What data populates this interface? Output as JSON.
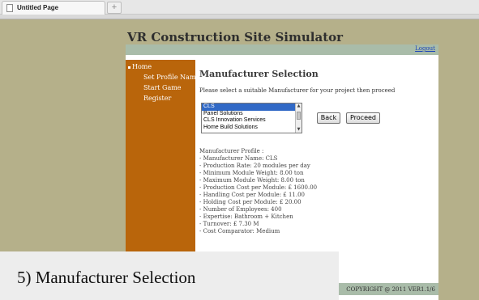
{
  "browser": {
    "tab_title": "Untitled Page",
    "newtab_glyph": "+"
  },
  "site": {
    "title": "VR Construction Site Simulator",
    "logout_label": "Logout"
  },
  "sidebar": {
    "items": [
      {
        "label": "Home"
      },
      {
        "label": "Set Profile Name"
      },
      {
        "label": "Start Game"
      },
      {
        "label": "Register"
      }
    ]
  },
  "main": {
    "heading": "Manufacturer Selection",
    "instruction": "Please select a suitable Manufacturer for your project then proceed",
    "manufacturers": [
      "CLS",
      "Panel Solutions",
      "CLS Innovation Services",
      "Home Build Solutions"
    ],
    "selected_manufacturer": "CLS",
    "back_label": "Back",
    "proceed_label": "Proceed"
  },
  "profile": {
    "title": "Manufacturer Profile :",
    "lines": [
      "- Manufacturer Name: CLS",
      "- Production Rate: 20 modules per day",
      "- Minimum Module Weight: 8.00 ton",
      "- Maximum Module Weight: 8.00 ton",
      "- Production Cost per Module: £ 1600.00",
      "- Handling Cost per Module: £ 11.00",
      "- Holding Cost per Module: £ 20.00",
      "- Number of Employees: 400",
      "- Expertise: Bathroom + Kitchen",
      "- Turnover: £ 7.30 M",
      "- Cost Comparator: Medium"
    ]
  },
  "footer": {
    "copyright": "COPYRIGHT @ 2011 VER1.1/6"
  },
  "caption": "5) Manufacturer Selection"
}
